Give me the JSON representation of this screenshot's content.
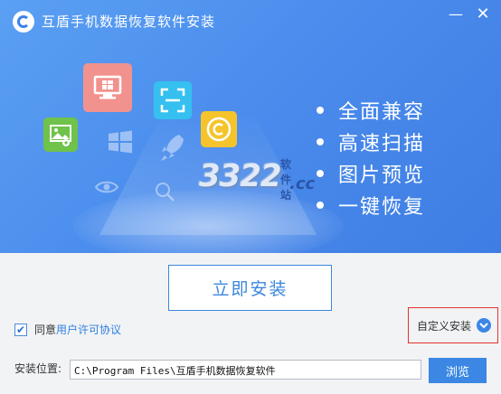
{
  "window": {
    "title": "互盾手机数据恢复软件安装",
    "minimize_glyph": "—",
    "close_glyph": "✕"
  },
  "banner": {
    "features": [
      "全面兼容",
      "高速扫描",
      "图片预览",
      "一键恢复"
    ],
    "watermark_number": "3322",
    "watermark_site": "软件站",
    "watermark_domain": ".cc"
  },
  "install": {
    "button_label": "立即安装"
  },
  "agreement": {
    "checked": true,
    "prefix": "同意",
    "link_text": "用户许可协议"
  },
  "custom_install": {
    "label": "自定义安装"
  },
  "path": {
    "label": "安装位置:",
    "value": "C:\\Program Files\\互盾手机数据恢复软件",
    "browse_label": "浏览"
  },
  "colors": {
    "banner_blue": "#4a8bec",
    "accent": "#3b87dc",
    "highlight_border": "#e2322f",
    "tile_monitor": "#f2928e",
    "tile_scan": "#35c0f0",
    "tile_copyright": "#f5c42d",
    "tile_photo": "#6fc24a"
  },
  "icons": [
    "app-logo-icon",
    "monitor-windows-icon",
    "scan-icon",
    "copyright-icon",
    "photo-icon",
    "windows-icon",
    "rocket-icon",
    "eye-icon",
    "search-icon",
    "chevron-down-icon",
    "check-icon"
  ]
}
